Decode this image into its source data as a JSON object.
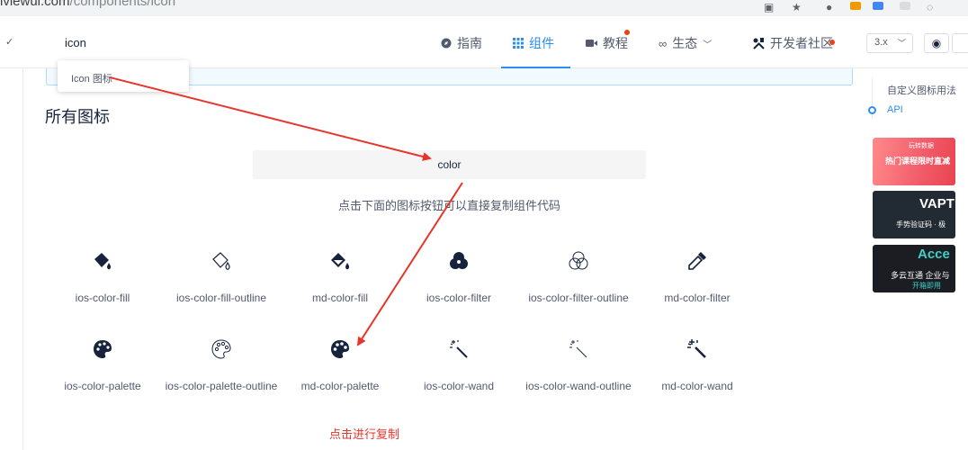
{
  "browser": {
    "url_host": "iviewui.com",
    "url_path": "/components/icon"
  },
  "nav": {
    "search_value": "icon",
    "items": [
      {
        "label": "指南",
        "icon": "compass-icon"
      },
      {
        "label": "组件",
        "icon": "grid-icon",
        "active": true
      },
      {
        "label": "教程",
        "icon": "video-icon",
        "badge": true
      },
      {
        "label": "生态",
        "icon": "infinity-icon",
        "dropdown": true
      },
      {
        "label": "开发者社区",
        "icon": "tools-icon",
        "badge": true
      }
    ],
    "version": "3.x",
    "accent_color": "#2d8cf0",
    "badge_color": "#ed4014"
  },
  "search_dropdown": {
    "item": "Icon 图标"
  },
  "section": {
    "title": "所有图标",
    "filter_value": "color",
    "hint": "点击下面的图标按钮可以直接复制组件代码"
  },
  "icons": [
    {
      "name": "ios-color-fill"
    },
    {
      "name": "ios-color-fill-outline"
    },
    {
      "name": "md-color-fill"
    },
    {
      "name": "ios-color-filter"
    },
    {
      "name": "ios-color-filter-outline"
    },
    {
      "name": "md-color-filter"
    },
    {
      "name": "ios-color-palette"
    },
    {
      "name": "ios-color-palette-outline"
    },
    {
      "name": "md-color-palette"
    },
    {
      "name": "ios-color-wand"
    },
    {
      "name": "ios-color-wand-outline"
    },
    {
      "name": "md-color-wand"
    }
  ],
  "sidebar": {
    "anchors": [
      {
        "label": "自定义图标用法"
      },
      {
        "label": "API"
      }
    ],
    "ads": [
      {
        "line1": "热门课程限时直减",
        "line2": "玩转数据"
      },
      {
        "line1": "VAPT",
        "line2": "手势验证码 · 极"
      },
      {
        "line1": "Acce",
        "line2": "多云互通 企业与",
        "line3": "开箱即用"
      }
    ]
  },
  "annotation": {
    "text": "点击进行复制",
    "color": "#e8352b"
  }
}
